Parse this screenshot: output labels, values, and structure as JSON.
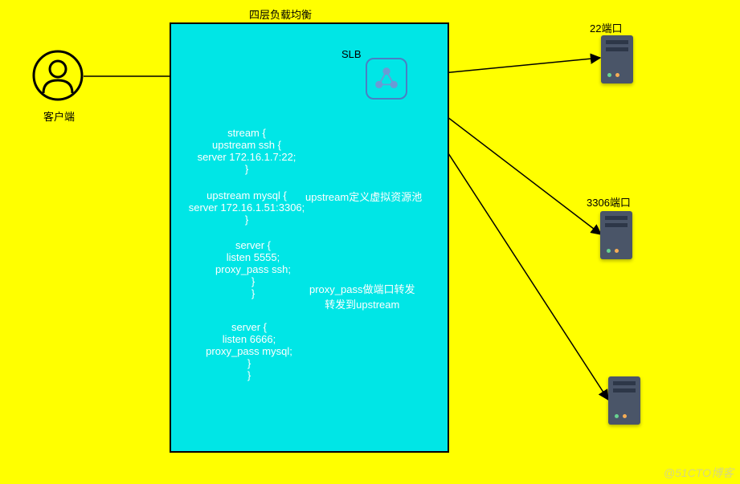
{
  "diagram": {
    "title": "四层负载均衡",
    "client_label": "客户端",
    "slb_label": "SLB",
    "config_block1": "stream {\nupstream ssh {\nserver 172.16.1.7:22;\n}",
    "config_block2": "upstream mysql {\nserver 172.16.1.51:3306;\n}",
    "config_block3": "server {\nlisten 5555;\nproxy_pass ssh;\n}\n}",
    "config_block4": "server {\nlisten 6666;\nproxy_pass mysql;\n}\n}",
    "note_upstream": "upstream定义虚拟资源池",
    "note_proxy": "proxy_pass做端口转发\n转发到upstream",
    "server_labels": {
      "top": "22端口",
      "mid": "3306端口"
    },
    "watermark": "@51CTO博客"
  }
}
